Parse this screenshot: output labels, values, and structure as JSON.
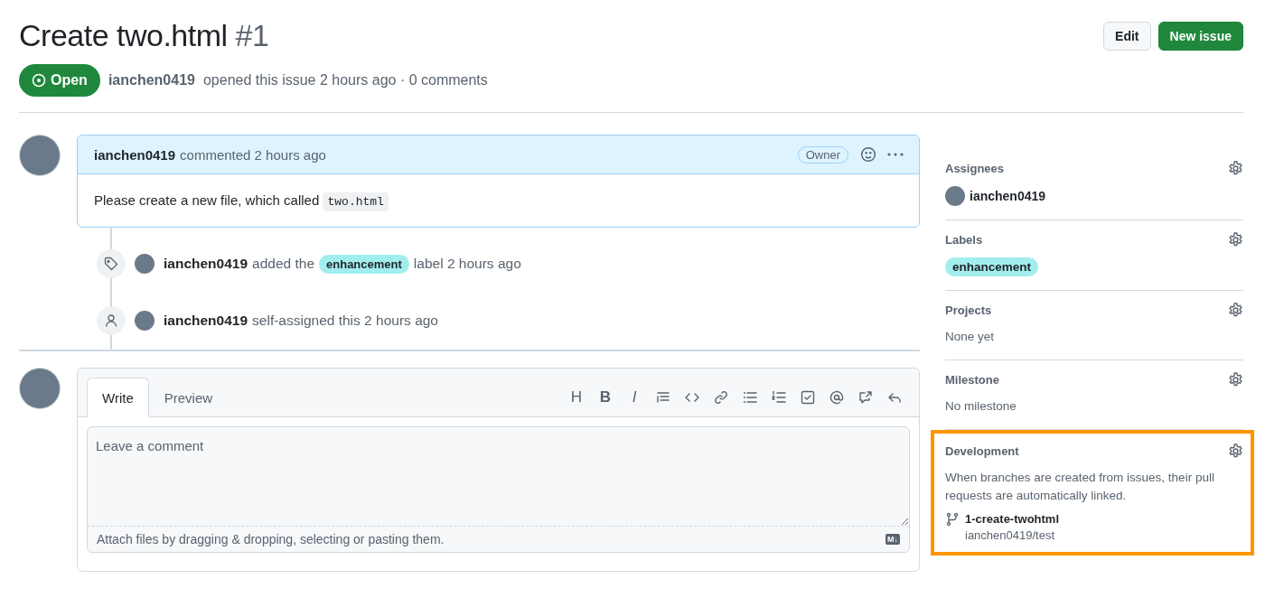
{
  "header": {
    "title": "Create two.html",
    "number": "#1",
    "buttons": [
      {
        "label": "Edit",
        "kind": "default"
      },
      {
        "label": "New issue",
        "kind": "primary"
      }
    ],
    "state": "Open",
    "author": "ianchen0419",
    "meta": "opened this issue 2 hours ago · 0 comments"
  },
  "comment": {
    "author": "ianchen0419",
    "meta": "commented 2 hours ago",
    "badge": "Owner",
    "body": "Please create a new file, which called ",
    "code": "two.html"
  },
  "events": [
    {
      "kind": "label",
      "actor": "ianchen0419",
      "before": "added the",
      "label": "enhancement",
      "color": "#a2eeef",
      "after": "label 2 hours ago"
    },
    {
      "kind": "assign",
      "actor": "ianchen0419",
      "before": "self-assigned this 2 hours ago"
    }
  ],
  "editor": {
    "tabs": [
      {
        "label": "Write",
        "selected": true
      },
      {
        "label": "Preview",
        "selected": false
      }
    ],
    "toolbar": [
      {
        "kind": "heading",
        "glyph": "H"
      },
      {
        "kind": "bold",
        "glyph": "B"
      },
      {
        "kind": "italic",
        "glyph": "I"
      },
      {
        "kind": "quote"
      },
      {
        "kind": "code"
      },
      {
        "kind": "link"
      },
      {
        "kind": "ul"
      },
      {
        "kind": "ol"
      },
      {
        "kind": "task"
      },
      {
        "kind": "mention"
      },
      {
        "kind": "ref"
      },
      {
        "kind": "reply"
      }
    ],
    "placeholder": "Leave a comment",
    "footer": "Attach files by dragging & dropping, selecting or pasting them.",
    "md_badge": "M↓"
  },
  "sidebar": [
    {
      "kind": "assignees",
      "title": "Assignees",
      "user": "ianchen0419",
      "highlighted": false
    },
    {
      "kind": "labels",
      "title": "Labels",
      "label": "enhancement",
      "color": "#a2eeef",
      "highlighted": false
    },
    {
      "kind": "text",
      "title": "Projects",
      "text": "None yet",
      "highlighted": false
    },
    {
      "kind": "text",
      "title": "Milestone",
      "text": "No milestone",
      "highlighted": false
    },
    {
      "kind": "development",
      "title": "Development",
      "text": "When branches are created from issues, their pull requests are automatically linked.",
      "branch": "1-create-twohtml",
      "repo": "ianchen0419/test",
      "highlighted": true
    }
  ]
}
